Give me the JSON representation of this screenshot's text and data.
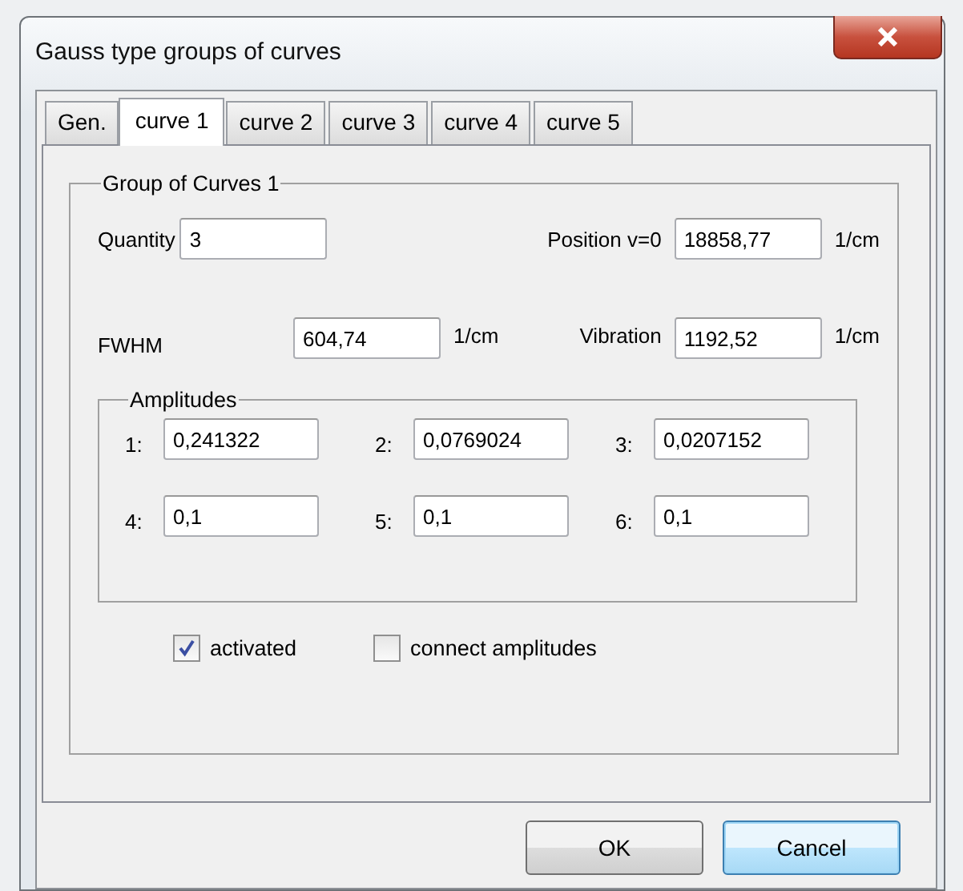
{
  "window": {
    "title": "Gauss type groups of curves"
  },
  "tabs": [
    {
      "label": "Gen.",
      "selected": false
    },
    {
      "label": "curve 1",
      "selected": true
    },
    {
      "label": "curve 2",
      "selected": false
    },
    {
      "label": "curve 3",
      "selected": false
    },
    {
      "label": "curve 4",
      "selected": false
    },
    {
      "label": "curve 5",
      "selected": false
    }
  ],
  "group": {
    "title": "Group of Curves 1",
    "quantity": {
      "label": "Quantity",
      "value": "3"
    },
    "position": {
      "label": "Position v=0",
      "value": "18858,77",
      "unit": "1/cm"
    },
    "fwhm": {
      "label": "FWHM",
      "value": "604,74",
      "unit": "1/cm"
    },
    "vibration": {
      "label": "Vibration",
      "value": "1192,52",
      "unit": "1/cm"
    },
    "amplitudes": {
      "title": "Amplitudes",
      "items": [
        {
          "label": "1:",
          "value": "0,241322"
        },
        {
          "label": "2:",
          "value": "0,0769024"
        },
        {
          "label": "3:",
          "value": "0,0207152"
        },
        {
          "label": "4:",
          "value": "0,1"
        },
        {
          "label": "5:",
          "value": "0,1"
        },
        {
          "label": "6:",
          "value": "0,1"
        }
      ]
    },
    "checkboxes": [
      {
        "label": "activated",
        "checked": true
      },
      {
        "label": "connect amplitudes",
        "checked": false
      }
    ]
  },
  "buttons": [
    {
      "label": "OK",
      "focused": false
    },
    {
      "label": "Cancel",
      "focused": true
    }
  ]
}
